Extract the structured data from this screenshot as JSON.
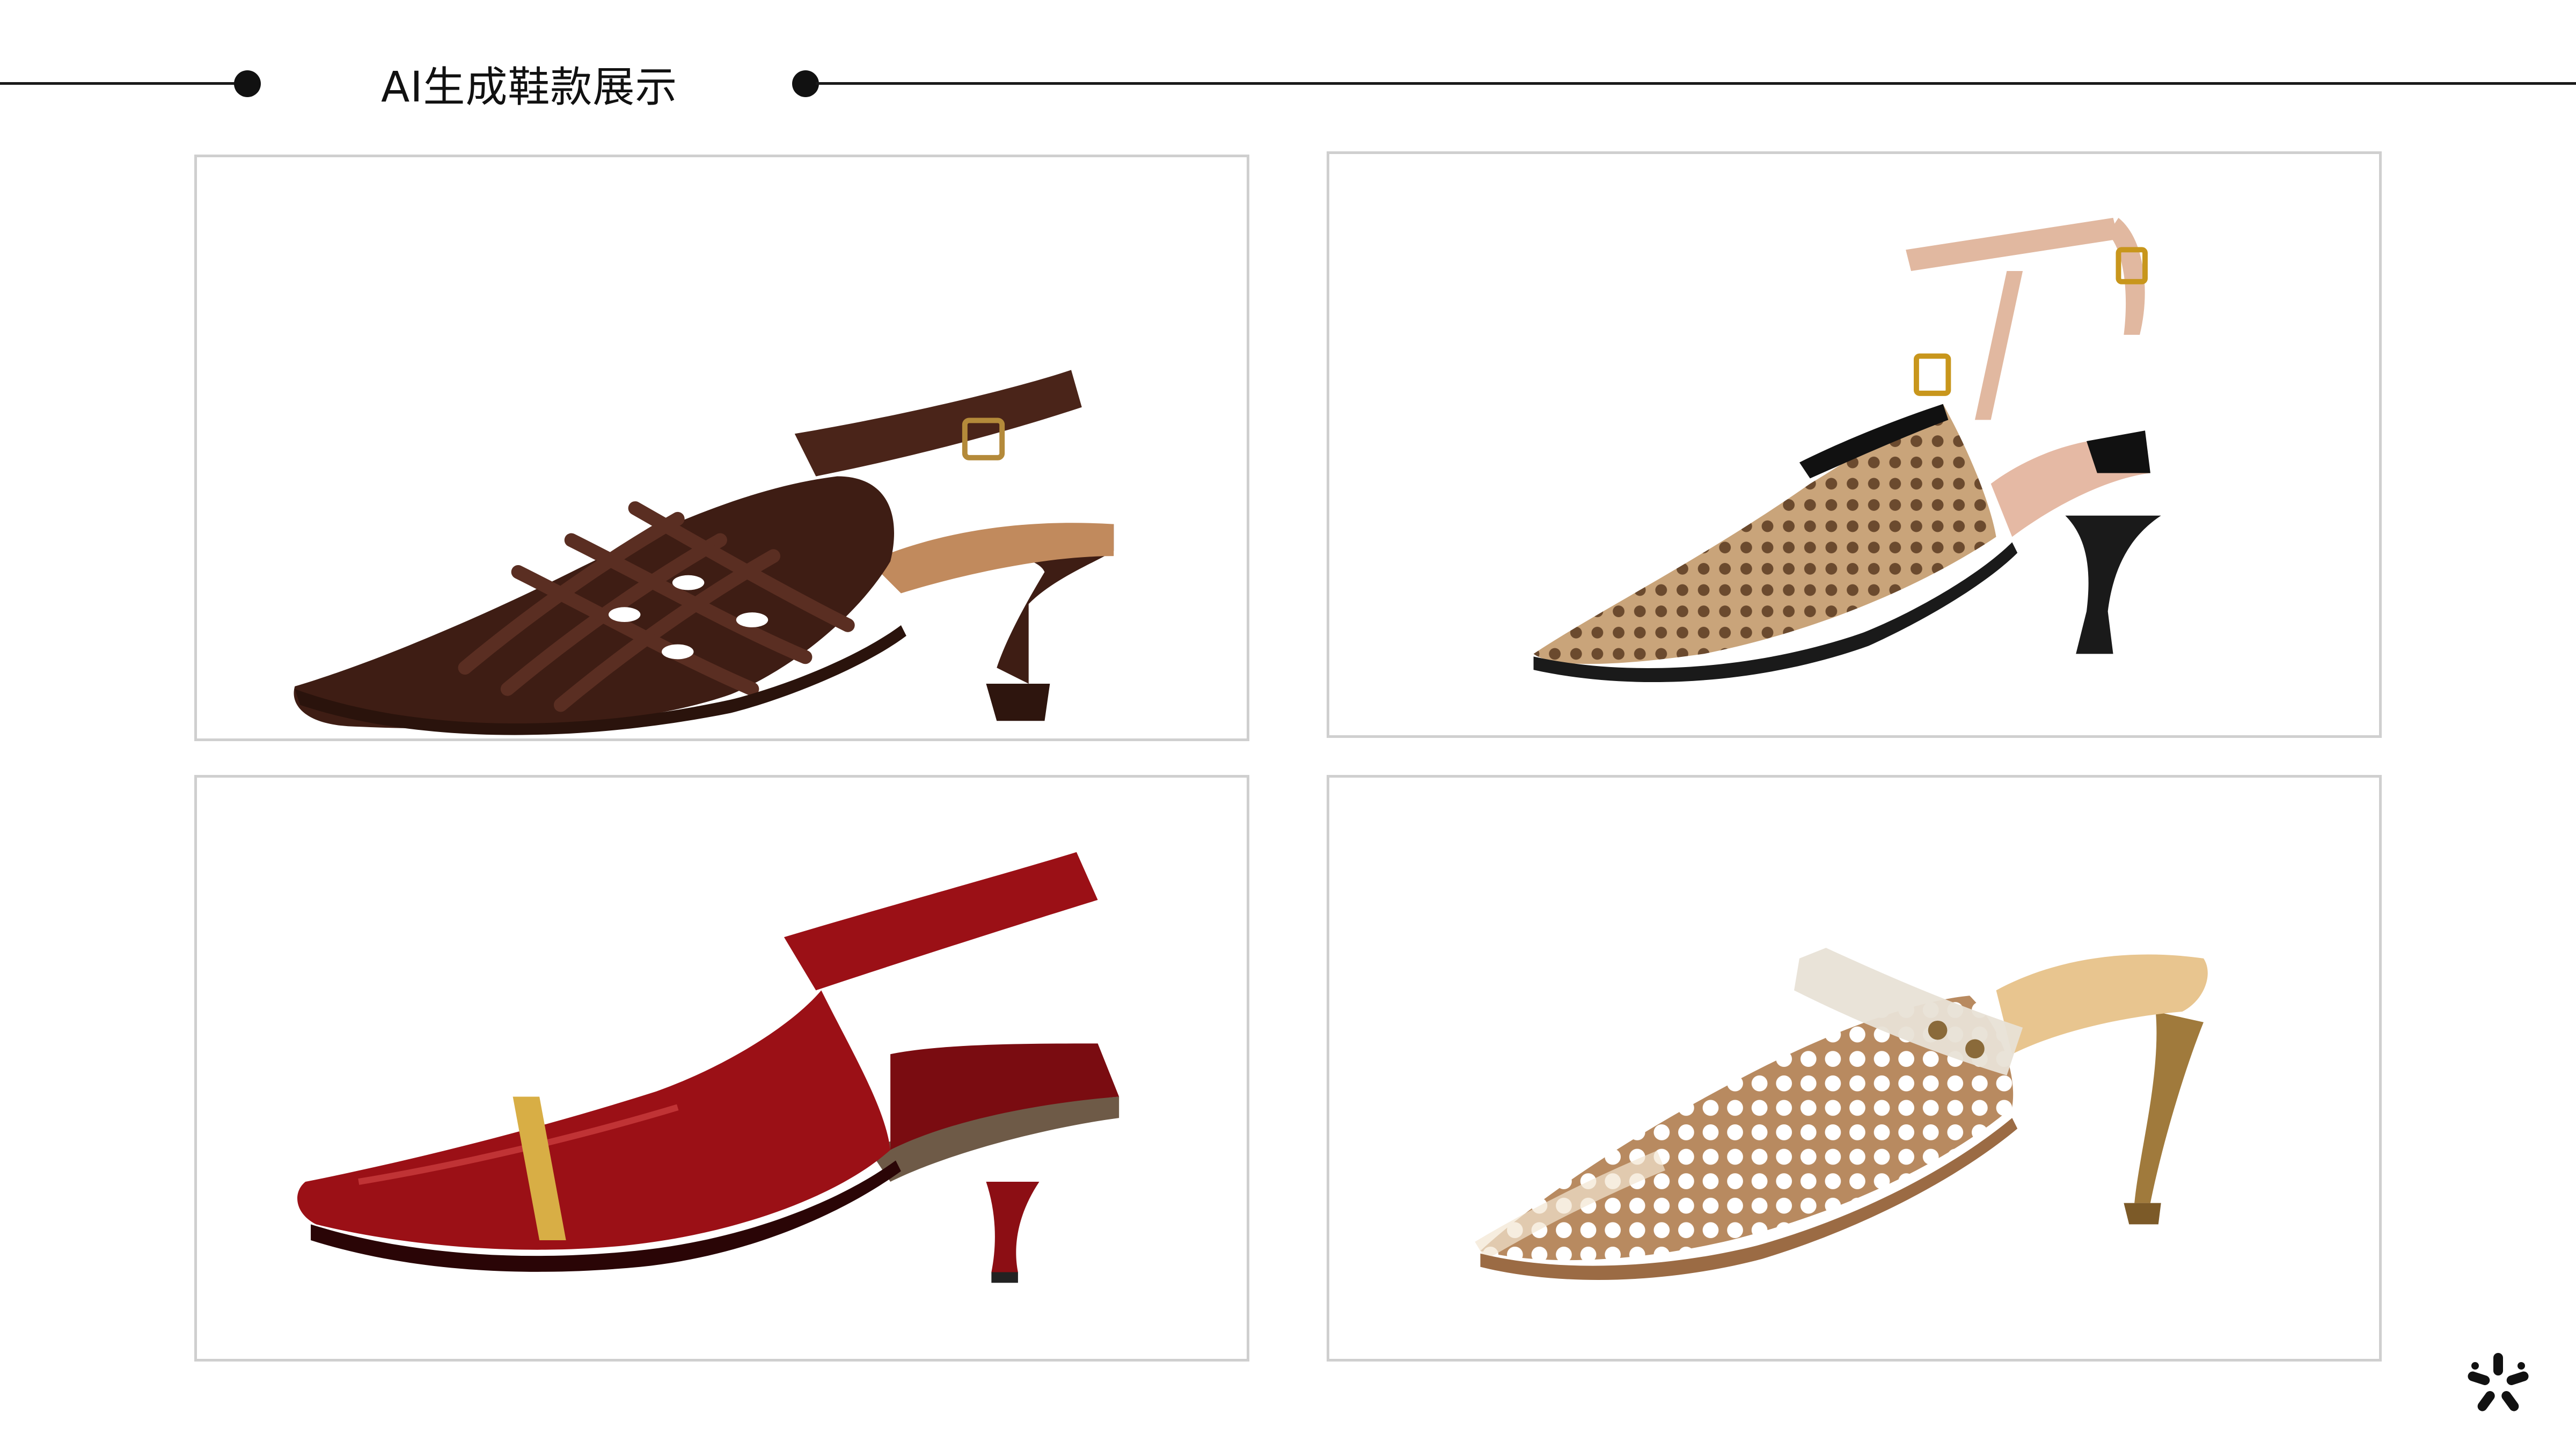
{
  "slide": {
    "title": "AI生成鞋款展示",
    "brand_icon": "flower-logo-icon"
  },
  "gallery": [
    {
      "name": "brown-woven-leather-slingback-icon",
      "color": "#3e1d14"
    },
    {
      "name": "rattan-t-strap-slingback-icon",
      "color": "#c9a47a"
    },
    {
      "name": "red-patent-slingback-icon",
      "color": "#9b1016"
    },
    {
      "name": "woven-mesh-mule-icon",
      "color": "#c9a47a"
    }
  ],
  "colors": {
    "rule": "#1a1a1a",
    "frame_border": "#cfcfcf",
    "text": "#111111"
  }
}
